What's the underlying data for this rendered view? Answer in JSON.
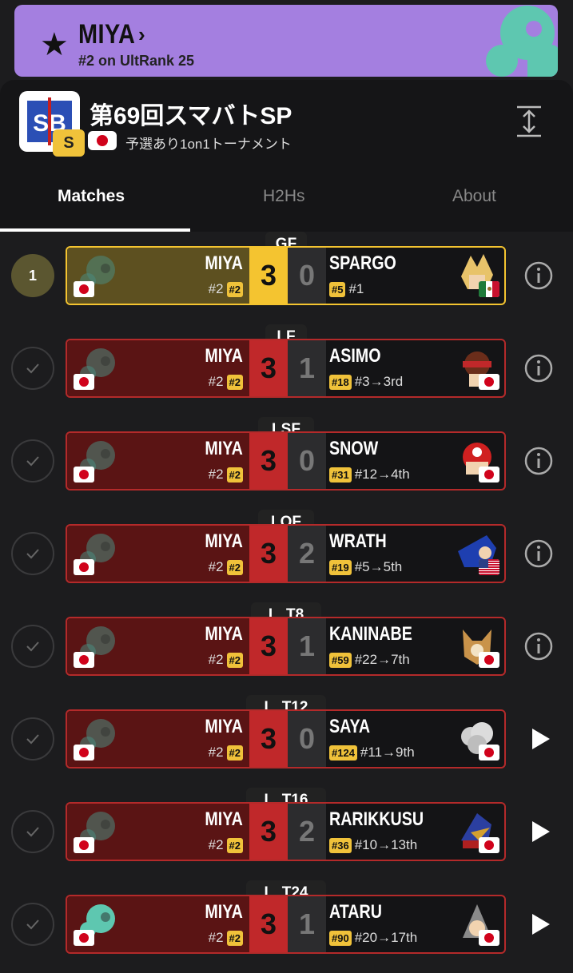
{
  "banner": {
    "player_name": "MIYA",
    "rank_text": "#2 on UltRank 25",
    "star_icon": "star-icon",
    "chevron_icon": "chevron-right-icon",
    "color": "#a47fe0"
  },
  "tournament": {
    "logo_text": "SB",
    "tier": "S",
    "title": "第69回スマバトSP",
    "subtitle": "予選あり1on1トーナメント"
  },
  "tabs": [
    {
      "label": "Matches",
      "active": true
    },
    {
      "label": "H2Hs",
      "active": false
    },
    {
      "label": "About",
      "active": false
    }
  ],
  "colors": {
    "win_red": "#c0282a",
    "win_gold": "#f4c430",
    "seed_badge": "#f0c23a"
  },
  "matches": [
    {
      "round": "GF",
      "status": "1",
      "p1_name": "MIYA",
      "p1_rank": "#2",
      "p1_seed": "#2",
      "p1_score": "3",
      "p2_score": "0",
      "p2_name": "SPARGO",
      "p2_seed": "#5",
      "p2_result": "#1",
      "p2_flag": "MX",
      "action": "info",
      "highlight": true
    },
    {
      "round": "LF",
      "status": "check",
      "p1_name": "MIYA",
      "p1_rank": "#2",
      "p1_seed": "#2",
      "p1_score": "3",
      "p2_score": "1",
      "p2_name": "ASIMO",
      "p2_seed": "#18",
      "p2_result": "#3→3rd",
      "p2_flag": "JP",
      "action": "info",
      "highlight": false
    },
    {
      "round": "LSF",
      "status": "check",
      "p1_name": "MIYA",
      "p1_rank": "#2",
      "p1_seed": "#2",
      "p1_score": "3",
      "p2_score": "0",
      "p2_name": "SNOW",
      "p2_seed": "#31",
      "p2_result": "#12→4th",
      "p2_flag": "JP",
      "action": "info",
      "highlight": false
    },
    {
      "round": "LQF",
      "status": "check",
      "p1_name": "MIYA",
      "p1_rank": "#2",
      "p1_seed": "#2",
      "p1_score": "3",
      "p2_score": "2",
      "p2_name": "WRATH",
      "p2_seed": "#19",
      "p2_result": "#5→5th",
      "p2_flag": "US",
      "action": "info",
      "highlight": false
    },
    {
      "round": "L. T8",
      "status": "check",
      "p1_name": "MIYA",
      "p1_rank": "#2",
      "p1_seed": "#2",
      "p1_score": "3",
      "p2_score": "1",
      "p2_name": "KANINABE",
      "p2_seed": "#59",
      "p2_result": "#22→7th",
      "p2_flag": "JP",
      "action": "info",
      "highlight": false
    },
    {
      "round": "L. T12",
      "status": "check",
      "p1_name": "MIYA",
      "p1_rank": "#2",
      "p1_seed": "#2",
      "p1_score": "3",
      "p2_score": "0",
      "p2_name": "SAYA",
      "p2_seed": "#124",
      "p2_result": "#11→9th",
      "p2_flag": "JP",
      "action": "play",
      "highlight": false
    },
    {
      "round": "L. T16",
      "status": "check",
      "p1_name": "MIYA",
      "p1_rank": "#2",
      "p1_seed": "#2",
      "p1_score": "3",
      "p2_score": "2",
      "p2_name": "RARIKKUSU",
      "p2_seed": "#36",
      "p2_result": "#10→13th",
      "p2_flag": "JP",
      "action": "play",
      "highlight": false
    },
    {
      "round": "L. T24",
      "status": "check",
      "p1_name": "MIYA",
      "p1_rank": "#2",
      "p1_seed": "#2",
      "p1_score": "3",
      "p2_score": "1",
      "p2_name": "ATARU",
      "p2_seed": "#90",
      "p2_result": "#20→17th",
      "p2_flag": "JP",
      "action": "play",
      "highlight": false
    }
  ]
}
